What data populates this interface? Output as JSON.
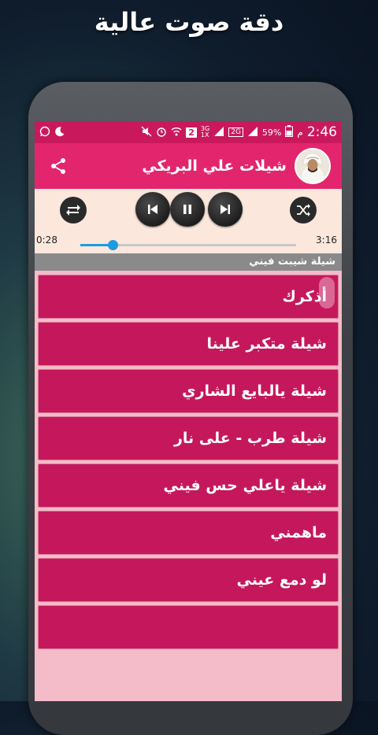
{
  "promo": {
    "title": "دقة صوت عالية"
  },
  "statusbar": {
    "time": "2:46",
    "battery": "59%",
    "sim_number": "2",
    "net_top": "3G",
    "net_bottom": "1X",
    "net2": "2G",
    "indicator": "م"
  },
  "appbar": {
    "title": "شيلات علي البريكي"
  },
  "player": {
    "elapsed": "0:28",
    "duration": "3:16",
    "progress": 0.148
  },
  "now_playing": "شيلة شيبت فيني",
  "songs": [
    "أذكرك",
    "شيلة متكبر علينا",
    "شيلة يالبايع الشاري",
    "شيلة طرب - على نار",
    "شيلة ياعلي حس فيني",
    "ماهمني",
    "لو دمع عيني",
    ""
  ],
  "colors": {
    "statusbar": "#c9195c",
    "appbar": "#e3256d",
    "list_item": "#c5185c",
    "seek_accent": "#1e9be0"
  },
  "icons": [
    "whatsapp-icon",
    "moon-icon",
    "mute-icon",
    "alarm-icon",
    "wifi-icon",
    "signal-icon",
    "battery-icon",
    "share-icon",
    "repeat-icon",
    "previous-icon",
    "pause-icon",
    "next-icon",
    "shuffle-icon"
  ]
}
